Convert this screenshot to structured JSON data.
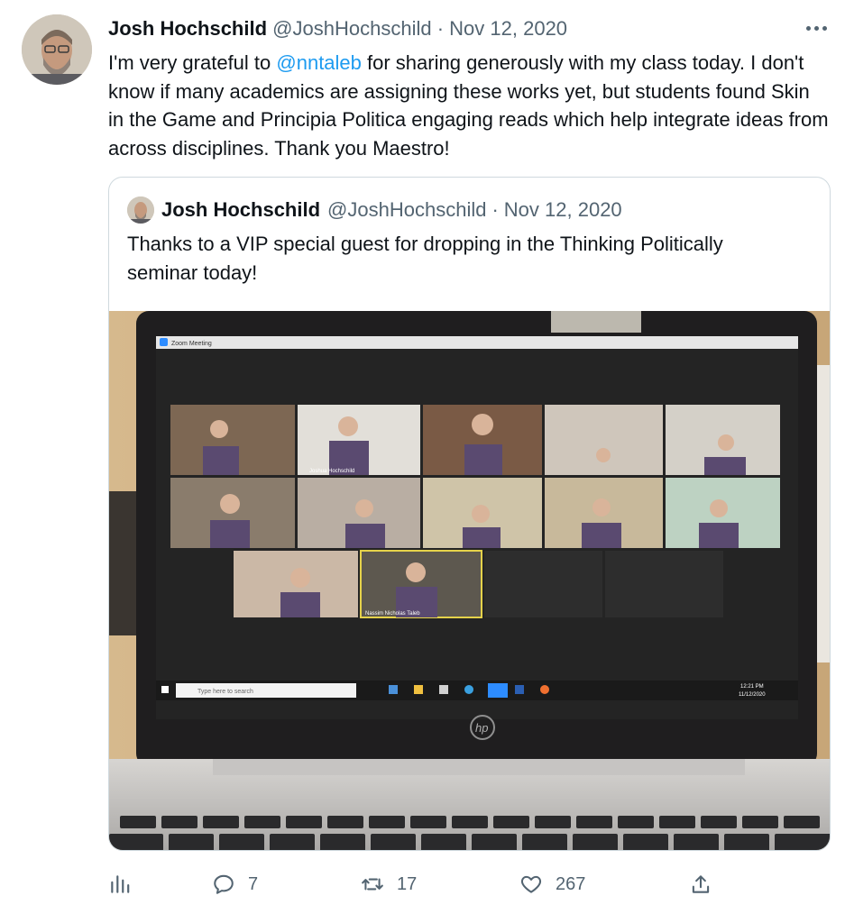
{
  "tweet": {
    "author_name": "Josh Hochschild",
    "handle": "@JoshHochschild",
    "separator": "·",
    "date": "Nov 12, 2020",
    "text_before": "I'm very grateful to ",
    "mention": "@nntaleb",
    "text_after": " for sharing generously with my class today. I don't know if many academics are assigning these works yet, but students found Skin in the Game and Principia Politica engaging reads which help integrate ideas from across disciplines. Thank you Maestro!"
  },
  "quoted": {
    "author_name": "Josh Hochschild",
    "handle": "@JoshHochschild",
    "separator": "·",
    "date": "Nov 12, 2020",
    "text": "Thanks to a VIP special guest for dropping in the Thinking Politically seminar today!",
    "photo": {
      "window_title": "Zoom Meeting",
      "search_placeholder": "Type here to search",
      "clock_time": "12:21 PM",
      "clock_date": "11/12/2020",
      "tile_labels": [
        "Joshua Hochschild",
        "Nassim Nicholas Taleb"
      ],
      "laptop_brand": "hp"
    }
  },
  "actions": {
    "replies": "7",
    "retweets": "17",
    "likes": "267"
  },
  "icons": {
    "more": "more-horizontal-icon",
    "analytics": "analytics-icon",
    "reply": "reply-icon",
    "retweet": "retweet-icon",
    "like": "heart-icon",
    "share": "share-icon"
  },
  "colors": {
    "link": "#1d9bf0",
    "muted": "#536471",
    "text": "#0f1419",
    "border": "#cfd9de"
  }
}
